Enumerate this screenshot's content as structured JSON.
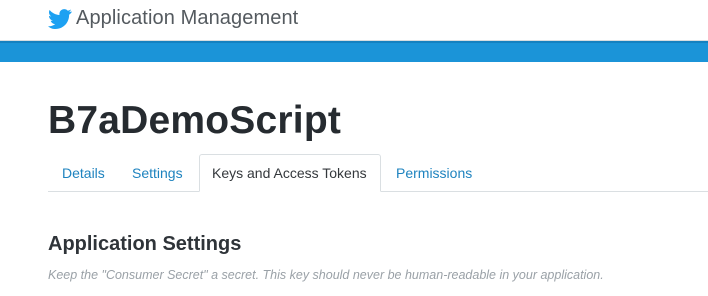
{
  "header": {
    "title": "Application Management",
    "logo_icon": "twitter-bird-icon",
    "accent_color": "#1b94d8"
  },
  "app": {
    "name": "B7aDemoScript"
  },
  "tabs": [
    {
      "label": "Details",
      "active": false
    },
    {
      "label": "Settings",
      "active": false
    },
    {
      "label": "Keys and Access Tokens",
      "active": true
    },
    {
      "label": "Permissions",
      "active": false
    }
  ],
  "section": {
    "title": "Application Settings",
    "note": "Keep the \"Consumer Secret\" a secret. This key should never be human-readable in your application."
  }
}
